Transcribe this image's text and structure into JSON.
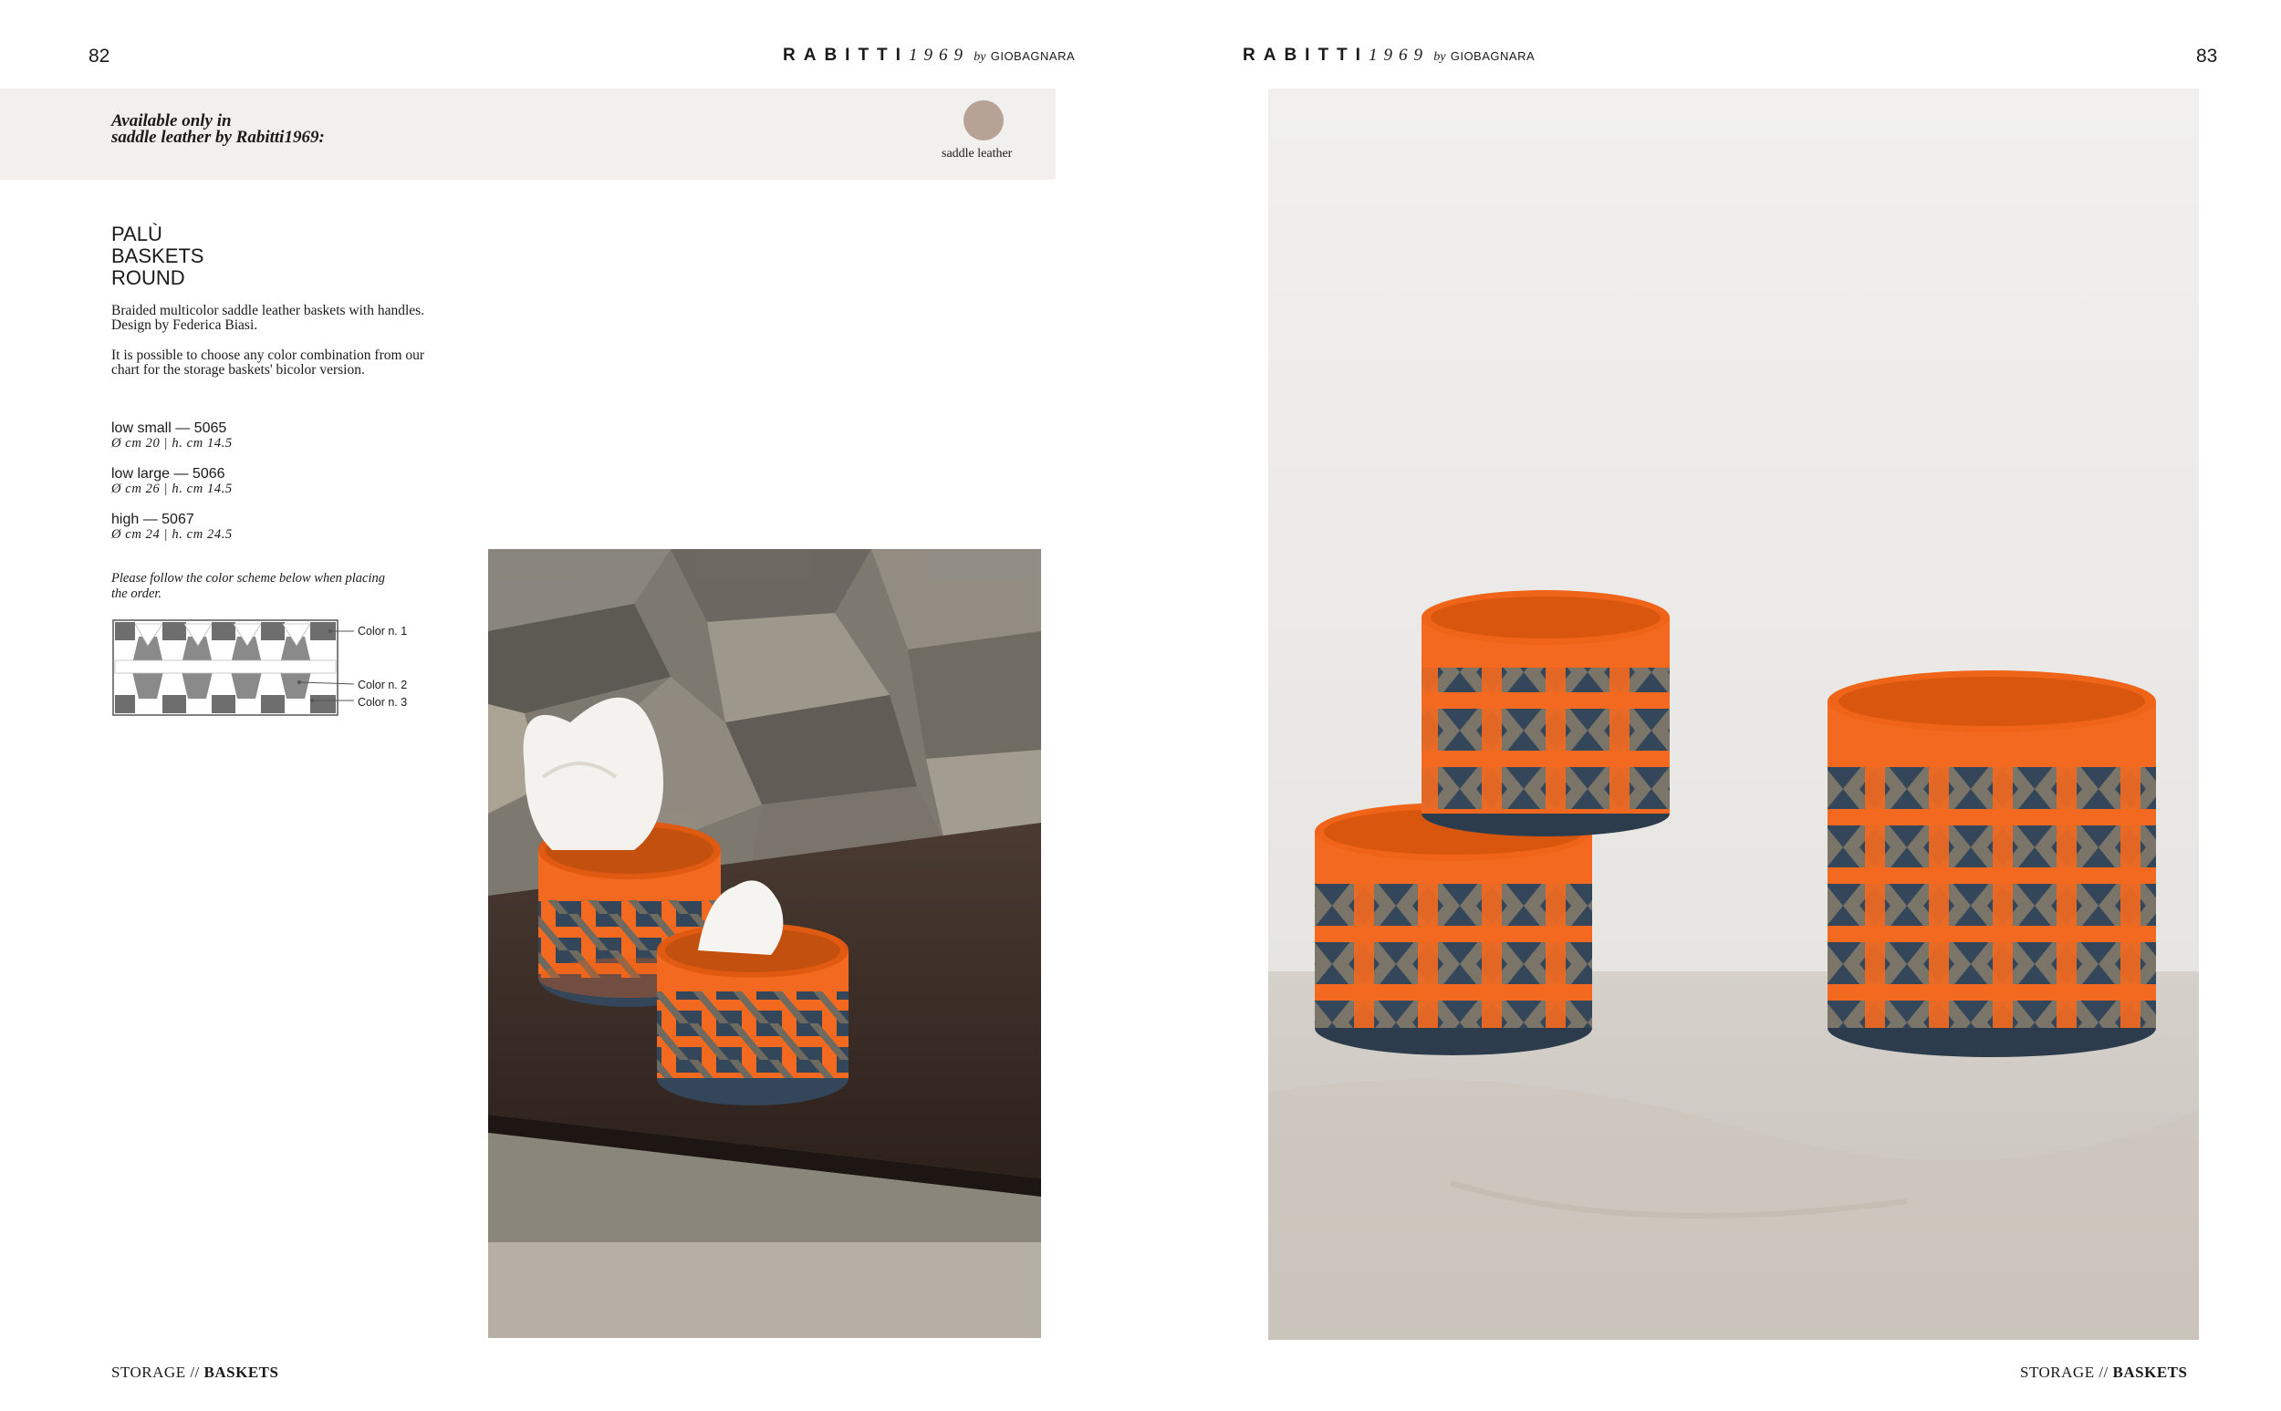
{
  "left_page": {
    "page_number": "82",
    "brand": {
      "name": "RABITTI",
      "year": "1969",
      "by": "by",
      "maker": "GIOBAGNARA"
    },
    "availability": {
      "text": "Available only in\nsaddle leather by Rabitti1969:",
      "swatch_label": "saddle leather",
      "swatch_color": "#b7a395"
    },
    "product": {
      "title_lines": [
        "PALÙ",
        "BASKETS",
        "ROUND"
      ],
      "description": [
        "Braided multicolor saddle leather baskets with handles.\nDesign by Federica Biasi.",
        "It is possible to choose any color combination from our chart for the storage baskets' bicolor version."
      ],
      "variants": [
        {
          "name": "low small — 5065",
          "dims": "Ø cm 20 | h. cm 14.5"
        },
        {
          "name": "low large — 5066",
          "dims": "Ø cm 26 | h. cm 14.5"
        },
        {
          "name": "high — 5067",
          "dims": "Ø cm 24 | h. cm 24.5"
        }
      ],
      "order_note": "Please follow the color scheme below when placing the order.",
      "scheme_labels": [
        "Color n. 1",
        "Color n. 2",
        "Color n. 3"
      ]
    },
    "footer": {
      "section": "STORAGE //",
      "category": "BASKETS"
    }
  },
  "right_page": {
    "page_number": "83",
    "brand": {
      "name": "RABITTI",
      "year": "1969",
      "by": "by",
      "maker": "GIOBAGNARA"
    },
    "footer": {
      "section": "STORAGE //",
      "category": "BASKETS"
    }
  },
  "colors": {
    "orange": "#f2691f",
    "navy": "#34475a",
    "taupe": "#7b7569",
    "band": "#f1f0ef"
  }
}
